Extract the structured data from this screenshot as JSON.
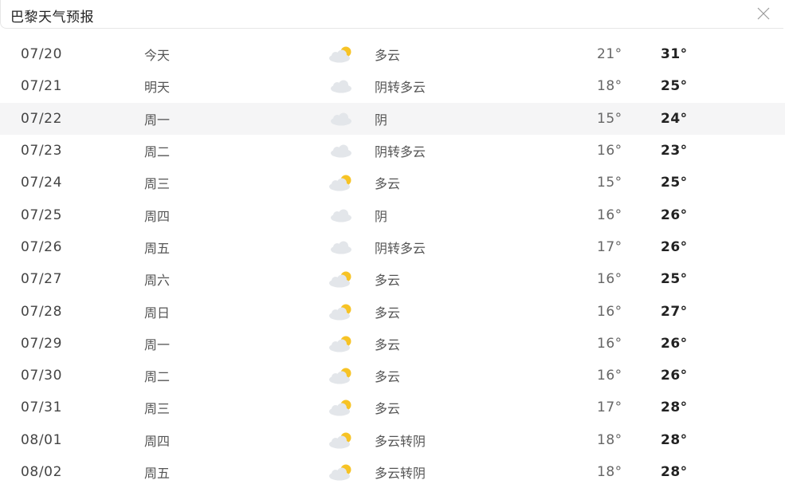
{
  "header": {
    "title": "巴黎天气预报"
  },
  "icons": {
    "close": "close-icon",
    "partly_cloudy": "partly-cloudy-icon",
    "overcast": "cloud-icon"
  },
  "colors": {
    "sun": "#f7c325",
    "cloud": "#e3e6ea",
    "highlight_row": "#f5f5f6"
  },
  "forecast": [
    {
      "date": "07/20",
      "weekday": "今天",
      "icon": "partly-cloudy",
      "desc": "多云",
      "low": "21°",
      "high": "31°"
    },
    {
      "date": "07/21",
      "weekday": "明天",
      "icon": "overcast",
      "desc": "阴转多云",
      "low": "18°",
      "high": "25°"
    },
    {
      "date": "07/22",
      "weekday": "周一",
      "icon": "overcast",
      "desc": "阴",
      "low": "15°",
      "high": "24°"
    },
    {
      "date": "07/23",
      "weekday": "周二",
      "icon": "overcast",
      "desc": "阴转多云",
      "low": "16°",
      "high": "23°"
    },
    {
      "date": "07/24",
      "weekday": "周三",
      "icon": "partly-cloudy",
      "desc": "多云",
      "low": "15°",
      "high": "25°"
    },
    {
      "date": "07/25",
      "weekday": "周四",
      "icon": "overcast",
      "desc": "阴",
      "low": "16°",
      "high": "26°"
    },
    {
      "date": "07/26",
      "weekday": "周五",
      "icon": "overcast",
      "desc": "阴转多云",
      "low": "17°",
      "high": "26°"
    },
    {
      "date": "07/27",
      "weekday": "周六",
      "icon": "partly-cloudy",
      "desc": "多云",
      "low": "16°",
      "high": "25°"
    },
    {
      "date": "07/28",
      "weekday": "周日",
      "icon": "partly-cloudy",
      "desc": "多云",
      "low": "16°",
      "high": "27°"
    },
    {
      "date": "07/29",
      "weekday": "周一",
      "icon": "partly-cloudy",
      "desc": "多云",
      "low": "16°",
      "high": "26°"
    },
    {
      "date": "07/30",
      "weekday": "周二",
      "icon": "partly-cloudy",
      "desc": "多云",
      "low": "16°",
      "high": "26°"
    },
    {
      "date": "07/31",
      "weekday": "周三",
      "icon": "partly-cloudy",
      "desc": "多云",
      "low": "17°",
      "high": "28°"
    },
    {
      "date": "08/01",
      "weekday": "周四",
      "icon": "partly-cloudy",
      "desc": "多云转阴",
      "low": "18°",
      "high": "28°"
    },
    {
      "date": "08/02",
      "weekday": "周五",
      "icon": "partly-cloudy",
      "desc": "多云转阴",
      "low": "18°",
      "high": "28°"
    }
  ]
}
